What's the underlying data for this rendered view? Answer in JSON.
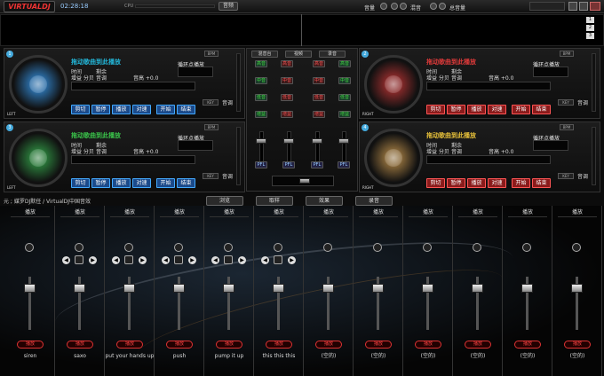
{
  "app": {
    "logo": "VIRTUALDJ",
    "time": "02:28:18",
    "cpu": "CPU"
  },
  "topbar": {
    "btn_record": "音频",
    "btn_phone": "音量",
    "btn_sfx": "混音",
    "btn_eq": "总音量"
  },
  "waveform": {
    "n1": "1",
    "n2": "2",
    "n3": "3"
  },
  "decks": [
    {
      "num": "1",
      "title": "拖动歌曲到此播放",
      "title_color": "#23b7d9",
      "color": "#2b6ea8",
      "side": "LEFT",
      "c1a": "时间",
      "c1b": "剩余",
      "c2": "增益 分贝",
      "c3": "音调",
      "c4": "音高 +0.0",
      "label": "循环点播放",
      "eq": "音调",
      "bpm": "BPM",
      "keyname": "KEY",
      "pads": [
        "剪切",
        "暂停",
        "播放",
        "对速"
      ],
      "pads2": [
        "开始",
        "结束"
      ]
    },
    {
      "num": "2",
      "title": "拖动歌曲到此播放",
      "title_color": "#e03a3a",
      "color": "#8a2a2a",
      "side": "RIGHT",
      "c1a": "时间",
      "c1b": "剩余",
      "c2": "增益 分贝",
      "c3": "音调",
      "c4": "音高 +0.0",
      "label": "循环点播放",
      "eq": "音调",
      "bpm": "BPM",
      "keyname": "KEY",
      "pads": [
        "剪切",
        "暂停",
        "播放",
        "对速"
      ],
      "pads2": [
        "开始",
        "结束"
      ]
    },
    {
      "num": "3",
      "title": "拖动歌曲到此播放",
      "title_color": "#3ac24a",
      "color": "#2a7a3a",
      "side": "LEFT",
      "c1a": "时间",
      "c1b": "剩余",
      "c2": "增益 分贝",
      "c3": "音调",
      "c4": "音高 +0.0",
      "label": "循环点播放",
      "eq": "音调",
      "bpm": "BPM",
      "keyname": "KEY",
      "pads": [
        "剪切",
        "暂停",
        "播放",
        "对速"
      ],
      "pads2": [
        "开始",
        "结束"
      ]
    },
    {
      "num": "4",
      "title": "拖动歌曲到此播放",
      "title_color": "#e6c03a",
      "color": "#8a6a3a",
      "side": "RIGHT",
      "c1a": "时间",
      "c1b": "剩余",
      "c2": "增益 分贝",
      "c3": "音调",
      "c4": "音高 +0.0",
      "label": "循环点播放",
      "eq": "音调",
      "bpm": "BPM",
      "keyname": "KEY",
      "pads": [
        "剪切",
        "暂停",
        "播放",
        "对速"
      ],
      "pads2": [
        "开始",
        "结束"
      ]
    }
  ],
  "mixer": {
    "tabs": [
      "混音台",
      "视频",
      "录音"
    ],
    "left_labels": [
      "高音",
      "中音",
      "低音",
      "增益"
    ],
    "right_labels": [
      "高音",
      "中音",
      "低音",
      "增益"
    ],
    "pfl": "PFL"
  },
  "breadcrumb": "元 ; 媒罗DJ默任 / VirtualDJ中国音效",
  "tabs": [
    "浏览",
    "取样",
    "效果",
    "录音"
  ],
  "sampler": {
    "play": "播放",
    "cols": [
      {
        "head": "播放",
        "name": "siren",
        "arrows": false
      },
      {
        "head": "播放",
        "name": "saxo",
        "arrows": true
      },
      {
        "head": "播放",
        "name": "put your hands up",
        "arrows": true
      },
      {
        "head": "播放",
        "name": "push",
        "arrows": true
      },
      {
        "head": "播放",
        "name": "pump it up",
        "arrows": true
      },
      {
        "head": "播放",
        "name": "this this this",
        "arrows": true
      },
      {
        "head": "播放",
        "name": "(空的)",
        "arrows": false
      },
      {
        "head": "播放",
        "name": "(空的)",
        "arrows": false
      },
      {
        "head": "播放",
        "name": "(空的)",
        "arrows": false
      },
      {
        "head": "播放",
        "name": "(空的)",
        "arrows": false
      },
      {
        "head": "播放",
        "name": "(空的)",
        "arrows": false
      },
      {
        "head": "播放",
        "name": "(空的)",
        "arrows": false
      }
    ]
  }
}
